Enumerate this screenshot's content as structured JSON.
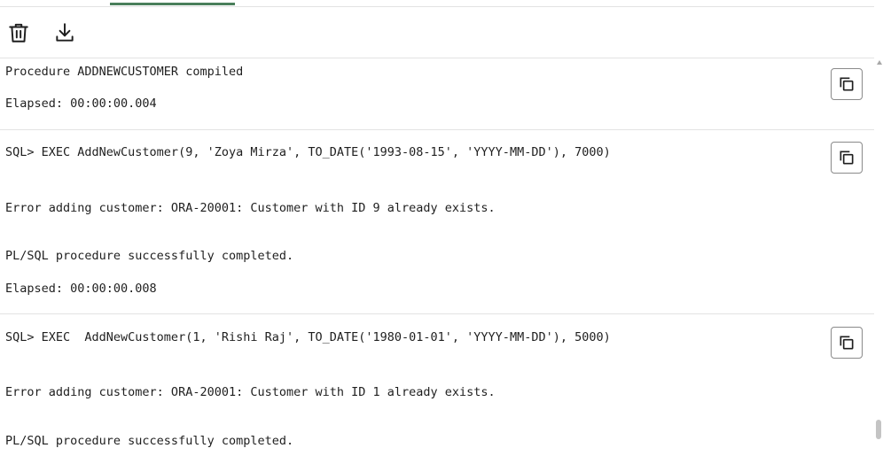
{
  "theme": {
    "accent": "#4a7f5b",
    "text": "#1f1f1f",
    "divider": "#e3e3e3"
  },
  "toolbar": {
    "clear_icon": "trash-icon",
    "download_icon": "download-icon"
  },
  "output": {
    "blocks": [
      {
        "lines": [
          "Procedure ADDNEWCUSTOMER compiled",
          "Elapsed: 00:00:00.004"
        ],
        "copy_icon": "copy-icon"
      },
      {
        "lines": [
          "SQL> EXEC AddNewCustomer(9, 'Zoya Mirza', TO_DATE('1993-08-15', 'YYYY-MM-DD'), 7000)",
          "Error adding customer: ORA-20001: Customer with ID 9 already exists.",
          "PL/SQL procedure successfully completed.",
          "Elapsed: 00:00:00.008"
        ],
        "copy_icon": "copy-icon"
      },
      {
        "lines": [
          "SQL> EXEC  AddNewCustomer(1, 'Rishi Raj', TO_DATE('1980-01-01', 'YYYY-MM-DD'), 5000)",
          "Error adding customer: ORA-20001: Customer with ID 1 already exists.",
          "PL/SQL procedure successfully completed."
        ],
        "copy_icon": "copy-icon"
      }
    ]
  }
}
